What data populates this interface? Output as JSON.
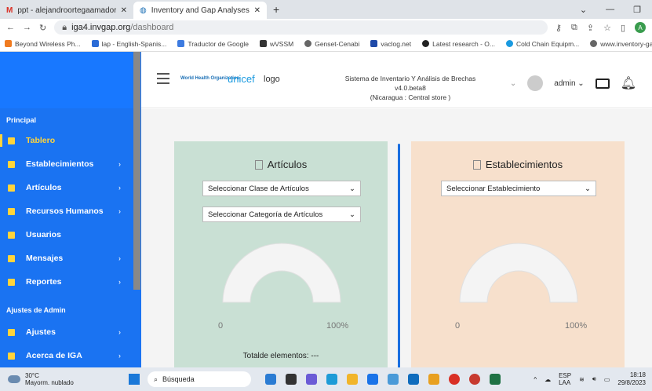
{
  "browser": {
    "tabs": [
      {
        "title": "ppt - alejandroortegaamador@...",
        "icon": "gmail-icon"
      },
      {
        "title": "Inventory and Gap Analyses",
        "icon": "who-icon"
      }
    ],
    "url_domain": "iga4.invgap.org",
    "url_path": "/dashboard",
    "profile_initial": "A",
    "bookmarks": [
      "Beyond Wireless Ph...",
      "lap - English-Spanis...",
      "Traductor de Google",
      "wVSSM",
      "Genset-Cenabi",
      "vaclog.net",
      "Latest research - O...",
      "Cold Chain Equipm...",
      "www.inventory-gap..."
    ]
  },
  "header": {
    "logo_who": "World Health Organization",
    "logo_unicef": "unicef",
    "logo_broken": "logo",
    "system_title": "Sistema de Inventario Y Análisis de Brechas",
    "version": "v4.0.beta8",
    "location": "(Nicaragua : Central store )",
    "user": "admin"
  },
  "sidebar": {
    "section_main": "Principal",
    "items": [
      {
        "label": "Tablero",
        "active": true,
        "arrow": false
      },
      {
        "label": "Establecimientos",
        "active": false,
        "arrow": true
      },
      {
        "label": "Artículos",
        "active": false,
        "arrow": true
      },
      {
        "label": "Recursos Humanos",
        "active": false,
        "arrow": true
      },
      {
        "label": "Usuarios",
        "active": false,
        "arrow": false
      },
      {
        "label": "Mensajes",
        "active": false,
        "arrow": true
      },
      {
        "label": "Reportes",
        "active": false,
        "arrow": true
      }
    ],
    "section_admin": "Ajustes de Admin",
    "admin_items": [
      {
        "label": "Ajustes",
        "arrow": true
      },
      {
        "label": "Acerca de IGA",
        "arrow": true
      }
    ]
  },
  "articulos_card": {
    "title": "Artículos",
    "select_class": "Seleccionar Clase de Artículos",
    "select_category": "Seleccionar Categoría de Artículos",
    "gauge_min": "0",
    "gauge_max": "100%",
    "total_label": "Totalde elementos: ---"
  },
  "establecimientos_card": {
    "title": "Establecimientos",
    "select_facility": "Seleccionar Establecimiento",
    "gauge_min": "0",
    "gauge_max": "100%"
  },
  "taskbar": {
    "weather_temp": "30°C",
    "weather_desc": "Mayorm. nublado",
    "search": "Búsqueda",
    "lang": "ESP",
    "lang2": "LAA",
    "time": "18:18",
    "date": "29/8/2023"
  },
  "colors": {
    "sidebar": "#1a73f2",
    "active": "#ffd43b",
    "card_left": "#c9e0d4",
    "card_right": "#f7e0cc"
  }
}
